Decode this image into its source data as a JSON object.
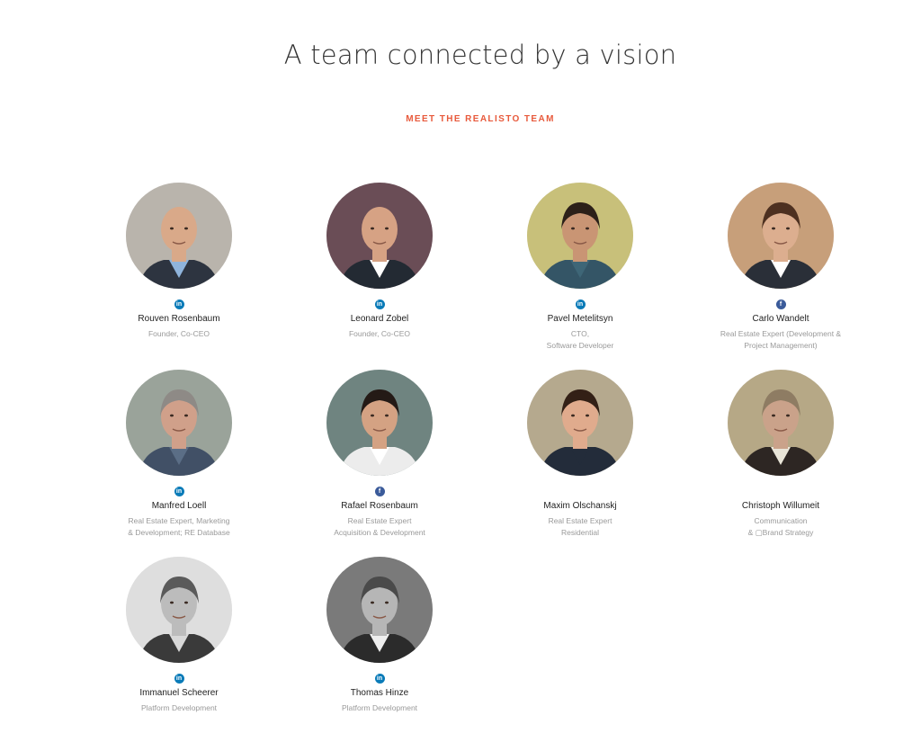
{
  "heading": "A team connected by a vision",
  "subheading": "MEET THE REALISTO TEAM",
  "members": [
    {
      "name": "Rouven Rosenbaum",
      "role_lines": [
        "Founder, Co-CEO"
      ],
      "social": "linkedin-icon",
      "bg": "#b9b4ac",
      "suit": "#2d3440",
      "shirt": "#8fb4dc",
      "skin": "#d9a989",
      "hair": "none"
    },
    {
      "name": "Leonard Zobel",
      "role_lines": [
        "Founder, Co-CEO"
      ],
      "social": "linkedin-icon",
      "bg": "#6a4d56",
      "suit": "#232a33",
      "shirt": "#ffffff",
      "skin": "#d6a284",
      "hair": "none"
    },
    {
      "name": "Pavel Metelitsyn",
      "role_lines": [
        "CTO,",
        "Software Developer"
      ],
      "social": "linkedin-icon",
      "bg": "#c8c07a",
      "suit": "#345566",
      "shirt": "#3e6677",
      "skin": "#c99574",
      "hair": "#2c2019"
    },
    {
      "name": "Carlo Wandelt",
      "role_lines": [
        "Real Estate Expert (Development &",
        "Project Management)"
      ],
      "social": "facebook-icon",
      "bg": "#c79f7a",
      "suit": "#2a2f38",
      "shirt": "#ffffff",
      "skin": "#dcae8f",
      "hair": "#4d3020"
    },
    {
      "name": "Manfred Loell",
      "role_lines": [
        "Real Estate Expert, Marketing",
        "& Development; RE Database"
      ],
      "social": "linkedin-icon",
      "bg": "#9aa39a",
      "suit": "#415066",
      "shirt": "#5b6e86",
      "skin": "#d0a08a",
      "hair": "#8e8a86"
    },
    {
      "name": "Rafael Rosenbaum",
      "role_lines": [
        "Real Estate Expert",
        "Acquisition & Development"
      ],
      "social": "facebook-icon",
      "bg": "#6f8480",
      "suit": "#ececec",
      "shirt": "#ffffff",
      "skin": "#d4a283",
      "hair": "#241a16"
    },
    {
      "name": "Maxim Olschanskj",
      "role_lines": [
        "Real Estate Expert",
        "Residential"
      ],
      "social": "none",
      "bg": "#b5a98e",
      "suit": "#232c3a",
      "shirt": "#232c3a",
      "skin": "#e0ab8d",
      "hair": "#332016"
    },
    {
      "name": "Christoph Willumeit",
      "role_lines": [
        "Communication",
        "& ▢Brand Strategy"
      ],
      "social": "none",
      "bg": "#b6a886",
      "suit": "#2d2623",
      "shirt": "#e9e5d8",
      "skin": "#caa28a",
      "hair": "#8e7c63"
    },
    {
      "name": "Immanuel Scheerer",
      "role_lines": [
        "Platform Development"
      ],
      "social": "linkedin-icon",
      "bg": "#dedede",
      "suit": "#3a3a3a",
      "shirt": "#d8d8d8",
      "skin": "#bcbcbc",
      "hair": "#5a5a5a"
    },
    {
      "name": "Thomas Hinze",
      "role_lines": [
        "Platform Development"
      ],
      "social": "linkedin-icon",
      "bg": "#7a7a7a",
      "suit": "#2b2b2b",
      "shirt": "#eeeeee",
      "skin": "#b6b6b6",
      "hair": "#4a4a4a"
    }
  ]
}
